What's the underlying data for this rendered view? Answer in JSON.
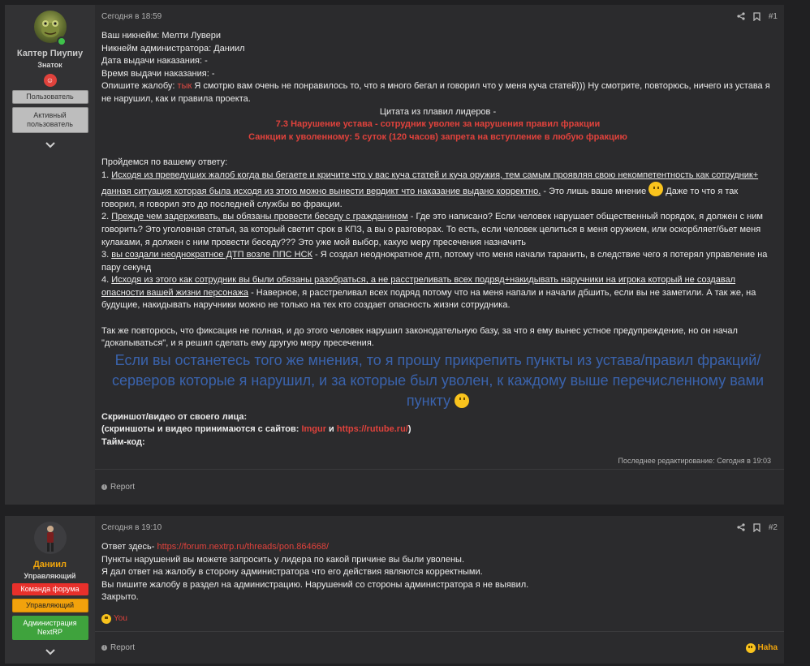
{
  "posts": [
    {
      "user": {
        "name": "Каптер Пиупиу",
        "title": "Знаток",
        "roles": [
          "Пользователь",
          "Активный пользователь"
        ],
        "avatar_icon": "frog-warrior-avatar"
      },
      "time": "Сегодня в 18:59",
      "number": "#1",
      "lines": {
        "l1": "Ваш никнейм: Мелти Лувери",
        "l2": "Никнейм администратора: Даниил",
        "l3": "Дата выдачи наказания: -",
        "l4": "Время выдачи наказания: -",
        "l5_prefix": "Опишите жалобу: ",
        "l5_red": "тык",
        "l5_rest": " Я смотрю вам очень не понравилось то, что я много бегал и говорил что у меня куча статей))) Ну смотрите, повторюсь, ничего из устава я не нарушил, как и правила проекта.",
        "quote_title": "Цитата из плавил лидеров -",
        "quote_r1": "7.3 Нарушение устава - сотрудник уволен за нарушения правил фракции",
        "quote_r2": "Санкции к уволенному: 5 суток (120 часов) запрета на вступление в любую фракцию",
        "intro": "Пройдемся по вашему ответу:",
        "p1_num": "1. ",
        "p1_ul": "Исходя из преведущих жалоб когда вы бегаете и кричите что у вас куча статей и куча оружия, тем самым проявляя свою некомпетентность как сотрудник+ данная ситуация которая была исходя из этого можно вынести вердикт что наказание выдано корректно.",
        "p1_rest": " - Это лишь ваше мнение ",
        "p1_end": " Даже то что я так говорил, я говорил это до последней службы во фракции.",
        "p2_num": "2. ",
        "p2_ul": "Прежде чем задерживать, вы обязаны провести беседу с гражданином",
        "p2_rest": " - Где это написано? Если человек нарушает общественный порядок, я должен с ним говорить? Это уголовная статья, за который светит срок в КПЗ, а вы о разговорах. То есть, если человек целиться в меня оружием, или оскорбляет/бьет меня кулаками, я должен с ним провести беседу??? Это уже мой выбор, какую меру пресечения назначить",
        "p3_num": "3. ",
        "p3_ul": "вы создали неоднократное ДТП возле ППС НСК",
        "p3_rest": " - Я создал неоднократное дтп, потому что меня начали таранить, в следствие чего я потерял управление на пару секунд",
        "p4_num": "4. ",
        "p4_ul": "Исходя из этого как сотрудник вы были обязаны разобраться, а не расстреливать всех подряд+накидывать наручники на игрока который не создавал опасности вашей жизни персонажа",
        "p4_rest": " - Наверное, я расстреливал всех подряд потому что на меня напали и начали дбшить, если вы не заметили. А так же, на будущие, накидывать наручники можно не только на тех кто создает опасность жизни сотрудника.",
        "para2": "Так же повторюсь, что фиксация не полная, и до этого человек нарушил законодательную базу, за что я ему вынес устное предупреждение, но он начал \"докапываться\", и я решил сделать ему другую меру пресечения.",
        "big": "Если вы останетесь того же мнения, то я прошу прикрепить пункты из устава/правил фракций/серверов которые я нарушил, и за которые был уволен, к каждому выше перечисленному вами пункту",
        "shot": "Скриншот/видео от своего лица:",
        "shot2_a": "(скриншоты и видео принимаются с сайтов: ",
        "shot2_l1": "Imgur",
        "shot2_b": " и ",
        "shot2_l2": "https://rutube.ru/",
        "shot2_c": ")",
        "timecode": "Тайм-код:"
      },
      "edited": "Последнее редактирование: Сегодня в 19:03",
      "report": "Report"
    },
    {
      "user": {
        "name": "Даниил",
        "title": "Управляющий",
        "roles": [
          "Команда форума",
          "Управляющий",
          "Администрация NextRP"
        ],
        "avatar_icon": "character-avatar"
      },
      "time": "Сегодня в 19:10",
      "number": "#2",
      "lines": {
        "l1_prefix": "Ответ здесь- ",
        "l1_link": "https://forum.nextrp.ru/threads/pon.864668/",
        "l2": "Пункты нарушений вы можете запросить у лидера по какой причине вы были уволены.",
        "l3": "Я дал ответ на жалобу в сторону администратора что его действия являются корректными.",
        "l4": "Вы пишите жалобу в раздел на администрацию. Нарушений со стороны администратора я не выявил.",
        "l5": "Закрыто."
      },
      "reaction": "You",
      "reaction_name": "Haha",
      "report": "Report"
    }
  ],
  "colors": {
    "accent_red": "#e0423c",
    "gold": "#f2a60c",
    "big_blue": "#3a63ad"
  }
}
